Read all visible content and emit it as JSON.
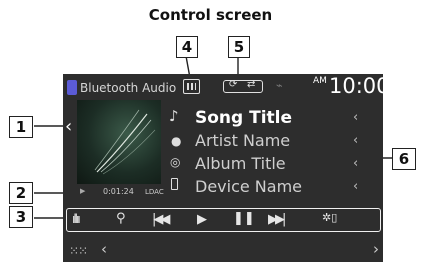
{
  "heading": "Control screen",
  "callouts": [
    "1",
    "2",
    "3",
    "4",
    "5",
    "6"
  ],
  "source": {
    "name": "Bluetooth Audio"
  },
  "clock": {
    "ampm": "AM",
    "time": "10:00"
  },
  "track": {
    "song_title": "Song Title",
    "artist_name": "Artist Name",
    "album_title": "Album Title",
    "device_name": "Device Name"
  },
  "playback": {
    "time": "0:01:24",
    "codec": "LDAC"
  },
  "icons": {
    "source": "phone-icon",
    "song": "music-note-icon",
    "artist": "person-icon",
    "album": "disc-icon",
    "device": "phone-icon",
    "equalizer": "equalizer-icon",
    "search": "search-icon",
    "prev": "skip-previous-icon",
    "play": "play-icon",
    "pause": "pause-icon",
    "next": "skip-next-icon",
    "device_settings": "device-settings-icon",
    "menu": "grid-menu-icon",
    "left": "chevron-left-icon",
    "right": "chevron-right-icon"
  },
  "colors": {
    "screen_bg": "#2d2d2d",
    "text": "#ffffff",
    "callout_border": "#222222"
  }
}
